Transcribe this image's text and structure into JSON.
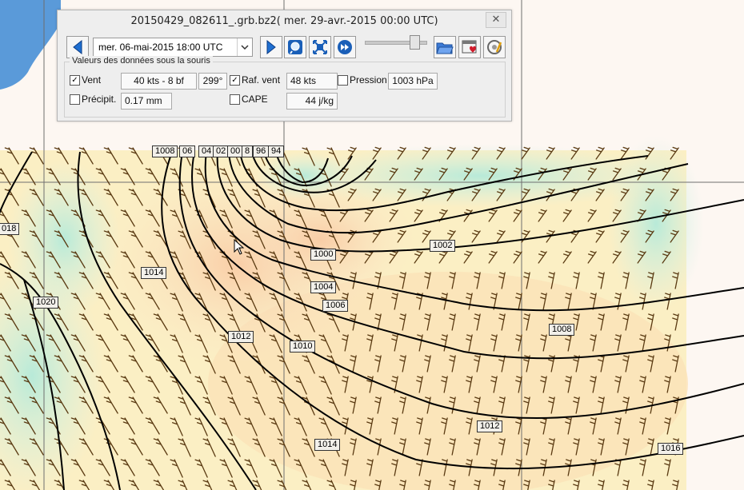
{
  "window": {
    "title": "20150429_082611_.grb.bz2( mer. 29-avr.-2015 00:00  UTC)",
    "close_symbol": "✕"
  },
  "toolbar": {
    "prev_icon": "left-triangle-icon",
    "date_value": "mer. 06-mai-2015 18:00  UTC",
    "next_icon": "right-triangle-icon",
    "zoom_icon": "magnifier-icon",
    "fit_icon": "fullscreen-icon",
    "play_icon": "fast-forward-icon",
    "slider_position": 0.85,
    "open_icon": "open-folder-icon",
    "favorite_icon": "heart-calendar-icon",
    "settings_icon": "settings-icon"
  },
  "data_panel": {
    "legend": "Valeurs des données sous la souris",
    "wind": {
      "label": "Vent",
      "checked": true,
      "speed": "40 kts -  8 bf",
      "direction": "299°"
    },
    "gust": {
      "label": "Raf. vent",
      "checked": true,
      "value": "48 kts"
    },
    "pressure": {
      "label": "Pression",
      "checked": false,
      "value": "1003 hPa"
    },
    "precip": {
      "label": "Précipit.",
      "checked": false,
      "value": "0.17 mm"
    },
    "cape": {
      "label": "CAPE",
      "checked": false,
      "value": "44 j/kg"
    }
  },
  "map": {
    "colors": {
      "sea_blue": "#5a9ad9",
      "warm": "#fbd9b0",
      "cool": "#cbeee2",
      "barb": "#5a3a12",
      "isobar": "#000000"
    },
    "isobar_labels": [
      "1008",
      "06",
      "04",
      "02",
      "00",
      "8",
      "96",
      "94",
      "018",
      "1014",
      "1020",
      "1000",
      "1002",
      "1004",
      "1006",
      "1012",
      "1010",
      "1008",
      "1012",
      "1014",
      "1016"
    ]
  }
}
